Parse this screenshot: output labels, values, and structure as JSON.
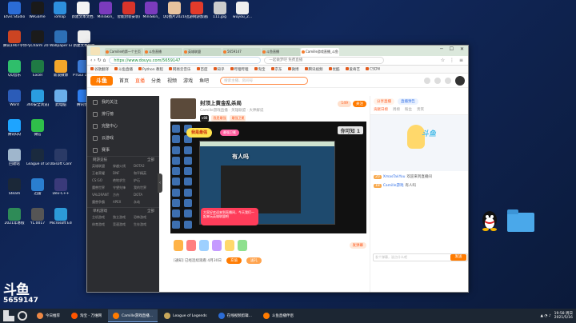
{
  "desktop": {
    "icons": [
      {
        "label": "Etvis Studio",
        "color": "#2b6cd6"
      },
      {
        "label": "WeGame",
        "color": "#1a1a1a"
      },
      {
        "label": "iomap",
        "color": "#2d8fdd"
      },
      {
        "label": "新建文本文档.txt",
        "color": "#f4f4f4"
      },
      {
        "label": "MiniSkin_",
        "color": "#7a3bbd"
      },
      {
        "label": "智能封装安装向导V2.5.e...",
        "color": "#d8342a"
      },
      {
        "label": "MiniSkin_",
        "color": "#7a3bbd"
      },
      {
        "label": "QQ图片20210326...",
        "color": "#e8c39e"
      },
      {
        "label": "迅游网游加速器",
        "color": "#e23b2b"
      },
      {
        "label": "111.jpg",
        "color": "#ccc"
      },
      {
        "label": "wuyou_2...",
        "color": "#eee"
      },
      {
        "label": "腾讯1907字体合集",
        "color": "#c42"
      },
      {
        "label": "PyCharm 2020.3.3 x64",
        "color": "#1b1b1b"
      },
      {
        "label": "Wallpaper Engine:...",
        "color": "#2d6fb5"
      },
      {
        "label": "新建文本文档",
        "color": "#eee"
      },
      {
        "label": "QQ音乐",
        "color": "#2fbe6b"
      },
      {
        "label": "Excel",
        "color": "#1f7a44"
      },
      {
        "label": "新浪微博",
        "color": "#f4a62a"
      },
      {
        "label": "PTGui 10.0.15",
        "color": "#3c7bd6"
      },
      {
        "label": "Word",
        "color": "#2b5cb8"
      },
      {
        "label": "360安全浏览器",
        "color": "#2a9de0"
      },
      {
        "label": "此电脑",
        "color": "#6aaeea"
      },
      {
        "label": "腾讯会议",
        "color": "#2f7ff0"
      },
      {
        "label": "腾讯QQ",
        "color": "#1ea4ff"
      },
      {
        "label": "微信",
        "color": "#2fbf4a"
      },
      {
        "label": "回收站",
        "color": "#9fb6cc"
      },
      {
        "label": "League of Legends",
        "color": "#1a2a3e"
      },
      {
        "label": "Ubisoft Connect",
        "color": "#2a3a66"
      },
      {
        "label": "Steam",
        "color": "#1b2838"
      },
      {
        "label": "迅雷",
        "color": "#2a7ed0"
      },
      {
        "label": "Dev-C++",
        "color": "#3a3a7a"
      },
      {
        "label": "2021年寒假",
        "color": "#2e8b57"
      },
      {
        "label": "YL.0017",
        "color": "#555"
      },
      {
        "label": "Microsoft Edge",
        "color": "#2c9ad8"
      }
    ],
    "watermark_logo": "斗鱼",
    "watermark_id": "5659147"
  },
  "browser": {
    "tabs": [
      {
        "title": "Camille的第一个主页"
      },
      {
        "title": "斗鱼直播"
      },
      {
        "title": "英雄联盟"
      },
      {
        "title": "5659147"
      },
      {
        "title": "斗鱼直播"
      },
      {
        "title": "Camille游戏直播_斗鱼"
      }
    ],
    "url": "https://www.douyu.com/5659147",
    "search_placeholder": "一起做梦吧 免费直播",
    "bookmarks": [
      "谷歌翻译",
      "斗鱼直播",
      "Python 教程",
      "网易云音乐",
      "百度",
      "知乎",
      "哔哩哔哩",
      "淘宝",
      "京东",
      "微博",
      "腾讯视频",
      "优酷",
      "爱奇艺",
      "CSDN"
    ]
  },
  "site": {
    "logo": "斗鱼",
    "nav": [
      "首页",
      "直播",
      "分类",
      "视频",
      "游戏",
      "鱼吧"
    ],
    "search_placeholder": "搜索主播、房间号",
    "sidebar": {
      "items": [
        "我的关注",
        "排行榜",
        "完整中心",
        "云游戏",
        "赛事"
      ],
      "section1": "网游竞技",
      "section1_more": "全部",
      "grid1": [
        "英雄联盟",
        "穿越火线",
        "DOTA2",
        "王者荣耀",
        "DNF",
        "和平精英",
        "CS:GO",
        "绝地求生",
        "炉石",
        "魔兽世界",
        "守望先锋",
        "我的世界",
        "VALORANT",
        "方舟",
        "DOTA",
        "魔兽争霸",
        "APEX",
        "永劫"
      ],
      "section2": "单机游戏",
      "section2_more": "全部",
      "grid2": [
        "主机游戏",
        "独立游戏",
        "恐怖游戏",
        "体育游戏",
        "竞速游戏",
        "生存游戏"
      ]
    },
    "room": {
      "title": "封顶上黄金乱杀局",
      "subtitle": "Camille游戏直播 · 英雄联盟 · 大神解说",
      "tags": [
        "v88",
        "我是最强",
        "最强卫冕"
      ],
      "follow_count": "149",
      "follow_label": "关注",
      "danmaku_hint": "发弹幕",
      "overlay_text": "有人吗",
      "counter": "你可知 1",
      "bubble_text": "大家好欢迎来到直播间，今天我们一起来玩英雄联盟吧",
      "stat_text": "[通知] 已经连续观看 4月30日",
      "btn1": "充值",
      "btn2": "送礼"
    },
    "right": {
      "top_btn1": "分享直播",
      "top_btn2": "直播预告",
      "tabs": [
        "贡献日榜",
        "周榜",
        "粉丝",
        "贵宾"
      ],
      "fans_mascot_text": "斗鱼",
      "chat": [
        {
          "lv": "20",
          "name": "XmasTakYou",
          "msg": "欢迎来到直播间"
        },
        {
          "lv": "18",
          "name": "Camille游戏",
          "msg": "有人吗"
        }
      ],
      "chat_placeholder": "发个弹幕，说点什么吧",
      "send_label": "发送"
    }
  },
  "taskbar": {
    "items": [
      {
        "label": "今日推荐",
        "color": "#e84"
      },
      {
        "label": "淘宝 - 万维网",
        "color": "#f50"
      },
      {
        "label": "Camille游戏直播...",
        "color": "#ff7b00",
        "active": true
      },
      {
        "label": "League of Legends",
        "color": "#c9a85b"
      },
      {
        "label": "在线视频剪辑...",
        "color": "#2b6cd6"
      },
      {
        "label": "斗鱼直播伴侣",
        "color": "#ff7b00"
      }
    ],
    "time": "19:58 周日",
    "date": "2021/5/16"
  }
}
